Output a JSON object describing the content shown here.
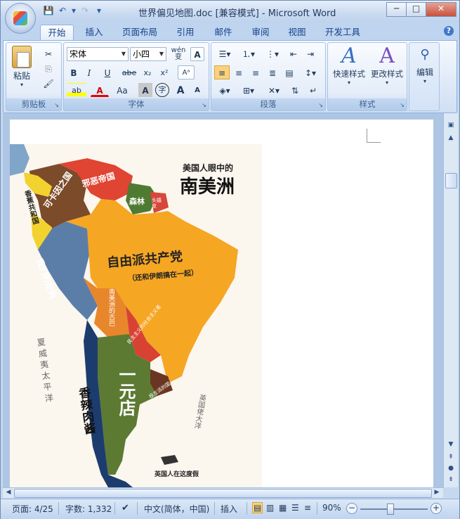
{
  "window": {
    "title": "世界偏见地图.doc [兼容模式] - Microsoft Word",
    "controls": {
      "minimize": "─",
      "maximize": "□",
      "close": "✕"
    }
  },
  "quick_access": {
    "save": "💾",
    "undo": "↶",
    "undo_dd": "▾",
    "redo": "↷",
    "customize": "▾"
  },
  "tabs": [
    "开始",
    "插入",
    "页面布局",
    "引用",
    "邮件",
    "审阅",
    "视图",
    "开发工具"
  ],
  "ribbon": {
    "clipboard": {
      "label": "剪贴板",
      "paste": "粘贴",
      "cut": "✂",
      "copy": "⎘",
      "format_painter": "🖌"
    },
    "font": {
      "label": "字体",
      "font_name": "宋体",
      "font_size": "小四",
      "phonetic": "wén 变",
      "char_border": "A",
      "bold": "B",
      "italic": "I",
      "underline": "U",
      "strike": "abe",
      "subscript": "x₂",
      "superscript": "x²",
      "clear": "Aᵃ",
      "highlight": "ab",
      "font_color": "A",
      "change_case": "Aa",
      "char_shading": "A",
      "enclose": "字",
      "grow": "A",
      "shrink": "A"
    },
    "paragraph": {
      "label": "段落"
    },
    "styles": {
      "label": "样式",
      "quick_styles": "快速样式",
      "change_styles": "更改样式"
    },
    "editing": {
      "label": "编辑"
    }
  },
  "map": {
    "title_small": "美国人眼中的",
    "title_big": "南美洲",
    "regions": {
      "evil_empire": "邪恶帝国",
      "forest": "森林",
      "hippie": "头嬉皮",
      "cocaine": "可卡因之国",
      "banana": "香蕉共和国",
      "drugs_route": "我们的走狗",
      "brazil": "自由派共产党",
      "brazil_sub": "（还和伊朗搞在一起）",
      "bolivia": "南美洲的古巴",
      "paraguay": "民主主义的社会主义者",
      "uruguay": "极左派的国",
      "argentina": "一元店",
      "chile": "香辣肉酱",
      "falkland": "英国人在这度假",
      "pacific": "夏威夷太平洋",
      "atlantic": "英国佬大洋"
    }
  },
  "status": {
    "page": "页面: 4/25",
    "words": "字数: 1,332",
    "language": "中文(简体，中国)",
    "mode": "插入",
    "zoom": "90%",
    "zoom_out": "−",
    "zoom_in": "+"
  }
}
